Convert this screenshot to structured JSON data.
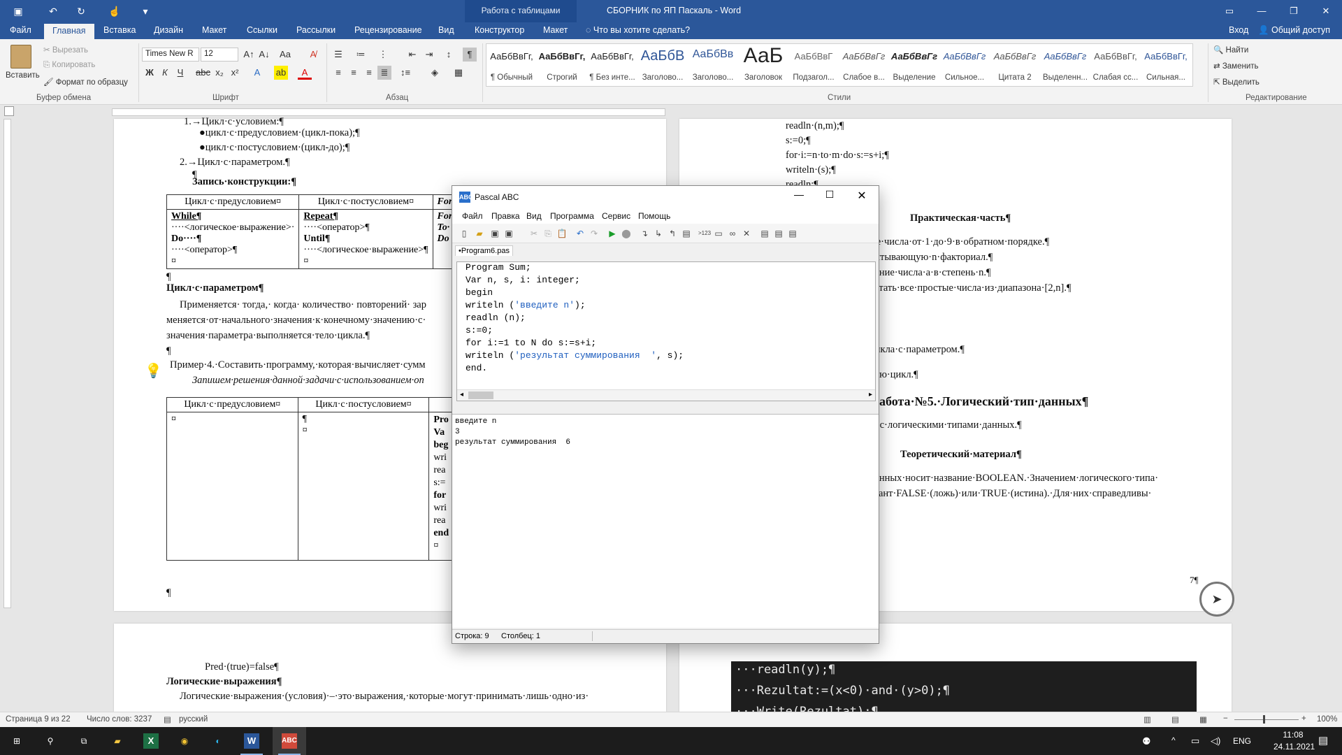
{
  "word": {
    "doc_title": "СБОРНИК по ЯП Паскаль - Word",
    "context_group": "Работа с таблицами",
    "tabs": [
      "Файл",
      "Главная",
      "Вставка",
      "Дизайн",
      "Макет",
      "Ссылки",
      "Рассылки",
      "Рецензирование",
      "Вид",
      "Конструктор",
      "Макет"
    ],
    "tell_me": "Что вы хотите сделать?",
    "signin": "Вход",
    "share": "Общий доступ",
    "clipboard": {
      "paste": "Вставить",
      "cut": "Вырезать",
      "copy": "Копировать",
      "format_painter": "Формат по образцу",
      "label": "Буфер обмена"
    },
    "font": {
      "name": "Times New R",
      "size": "12",
      "label": "Шрифт"
    },
    "paragraph": {
      "label": "Абзац"
    },
    "styles": {
      "label": "Стили",
      "items": [
        {
          "preview": "АаБбВвГг,",
          "name": "¶ Обычный"
        },
        {
          "preview": "АаБбВвГг,",
          "name": "Строгий"
        },
        {
          "preview": "АаБбВвГг,",
          "name": "¶ Без инте..."
        },
        {
          "preview": "АаБбВ",
          "name": "Заголово..."
        },
        {
          "preview": "АаБбВв",
          "name": "Заголово..."
        },
        {
          "preview": "АаБ",
          "name": "Заголовок"
        },
        {
          "preview": "АаБбВвГ",
          "name": "Подзагол..."
        },
        {
          "preview": "АаБбВвГг",
          "name": "Слабое в..."
        },
        {
          "preview": "АаБбВвГг",
          "name": "Выделение"
        },
        {
          "preview": "АаБбВвГг",
          "name": "Сильное..."
        },
        {
          "preview": "АаБбВвГг",
          "name": "Цитата 2"
        },
        {
          "preview": "АаБбВвГг",
          "name": "Выделенн..."
        },
        {
          "preview": "АаБбВвГг,",
          "name": "Слабая сс..."
        },
        {
          "preview": "АаБбВвГг,",
          "name": "Сильная..."
        }
      ]
    },
    "editing": {
      "find": "Найти",
      "replace": "Заменить",
      "select": "Выделить",
      "label": "Редактирование"
    },
    "status": {
      "page": "Страница 9 из 22",
      "words": "Число слов: 3237",
      "lang": "русский",
      "zoom": "100%"
    }
  },
  "doc_left": {
    "lines": [
      "1.→Цикл·с·условием:¶",
      "●цикл·с·предусловием·(цикл-пока);¶",
      "●цикл·с·постусловием·(цикл-до);¶",
      "2.→Цикл·с·параметром.¶",
      "¶",
      "Запись·конструкции:¶"
    ],
    "table1": {
      "headers": [
        "Цикл·с·предусловием¤",
        "Цикл·с·постусловием¤",
        "For"
      ],
      "col1": [
        "While¶",
        "····<логическое·выражение>·",
        "Do····¶",
        "····<оператор>¶",
        "¤"
      ],
      "col2": [
        "Repeat¶",
        "····<оператор>¶",
        "Until¶",
        "····<логическое·выражение>¶",
        "¤"
      ],
      "col3": [
        "For",
        "To·",
        "Do"
      ]
    },
    "after_table": "¶",
    "section_title": "Цикл·с·параметром¶",
    "para": [
      "Применяется· тогда,· когда· количество· повторений· зар",
      "меняется·от·начального·значения·к·конечному·значению·с·",
      "значения·параметра·выполняется·тело·цикла.¶",
      "¶"
    ],
    "example": "Пример·4.·Составить·программу,·которая·вычисляет·сумм",
    "example_italic": "Запишем·решения·данной·задачи·с·использованием·оп",
    "table2": {
      "headers": [
        "Цикл·с·предусловием¤",
        "Цикл·с·постусловием¤"
      ],
      "col1": "¤",
      "col2": [
        "¶",
        "¤"
      ],
      "col3": [
        "Pro",
        "Va",
        "beg",
        "wri",
        "rea",
        "s:=",
        "for",
        "wri",
        "rea",
        "end",
        "¤"
      ]
    },
    "end_mark": "¶"
  },
  "doc_right": {
    "lines_top": [
      "readln·(n,m);¶",
      "s:=0;¶",
      "for·i:=n·to·m·do·s:=s+i;¶",
      "writeln·(s);¶",
      "readln;¶"
    ],
    "practical": "Практическая·часть¶",
    "items": [
      "ые·числа·от·1·до·9·в·обратном·порядке.¶",
      "читывающую·n·факториал.¶",
      "дение·числа·a·в·степень·n.¶",
      "чатать·все·простые·числа·из·диапазона·[2,n].¶",
      "цикла·с·параметром.¶",
      "тию·цикл.¶"
    ],
    "lab_title": "·работа·№5.·Логический·тип·данных¶",
    "lab_sub": "ы·с·логическими·типами·данных.¶",
    "theory": "Теоретический·материал¶",
    "theory_p1": "данных·носит·название·BOOLEAN.·Значением·логического·типа·",
    "theory_p2": "стант·FALSE·(ложь)·или·TRUE·(истина).·Для·них·справедливы·",
    "page_num": "7¶"
  },
  "doc_left2": {
    "lines": [
      "Pred·(true)=false¶",
      "Логические·выражения¶",
      "Логические·выражения·(условия)·–·это·выражения,·которые·могут·принимать·лишь·одно·из·"
    ]
  },
  "dark_code": [
    "···readln(y);¶",
    "···Rezultat:=(x<0)·and·(y>0);¶",
    "···Write(Rezultat);¶"
  ],
  "pascal": {
    "title": "Pascal ABC",
    "menu": [
      "Файл",
      "Правка",
      "Вид",
      "Программа",
      "Сервис",
      "Помощь"
    ],
    "tab": "•Program6.pas",
    "code": [
      {
        "t": "Program Sum;"
      },
      {
        "t": "Var n, s, i: integer;"
      },
      {
        "t": "begin"
      },
      {
        "pre": "writeln (",
        "str": "'введите n'",
        "post": ");"
      },
      {
        "t": "readln (n);"
      },
      {
        "t": "s:=0;"
      },
      {
        "t": "for i:=1 to N do s:=s+i;"
      },
      {
        "pre": "writeln (",
        "str": "'результат суммирования  '",
        "post": ", s);"
      },
      {
        "t": "end."
      }
    ],
    "output": [
      "введите n",
      "3",
      "результат суммирования  6"
    ],
    "status_line": "Строка: 9",
    "status_col": "Столбец: 1"
  },
  "taskbar": {
    "lang": "ENG",
    "time": "11:08",
    "date": "24.11.2021"
  }
}
